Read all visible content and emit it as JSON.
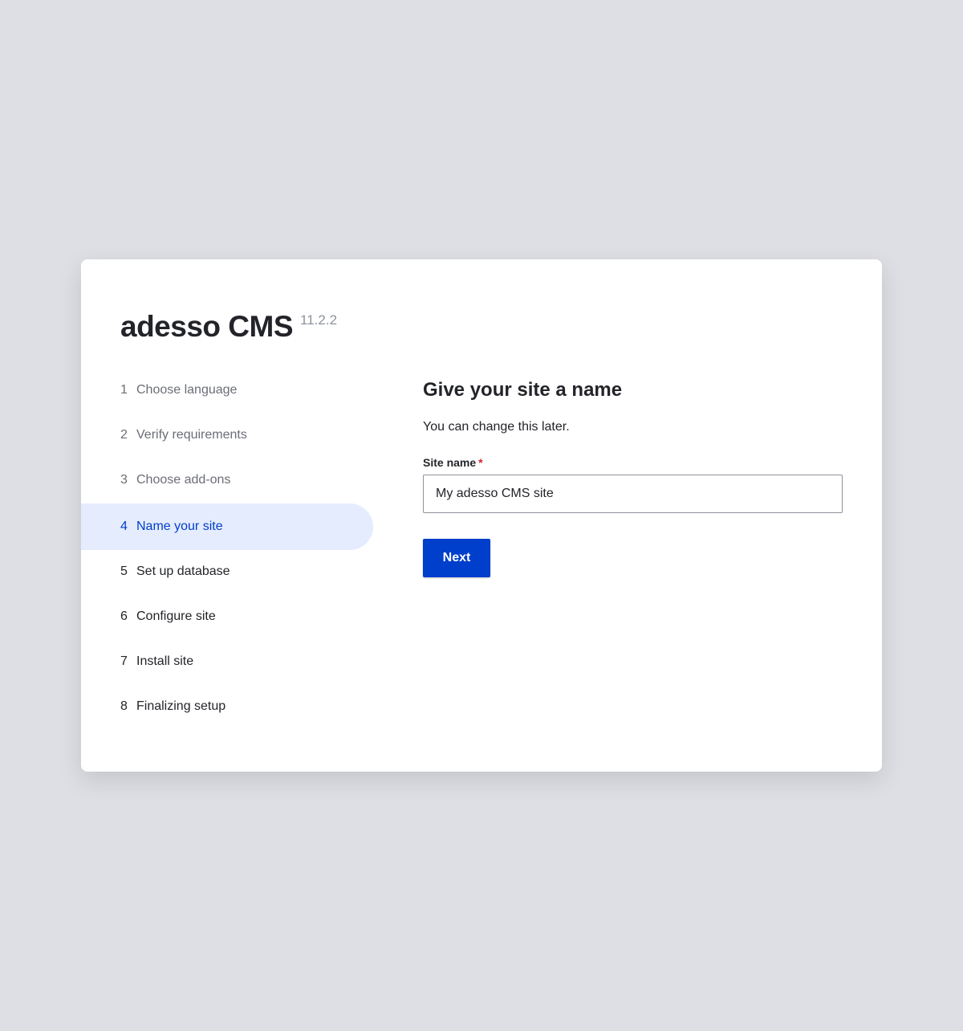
{
  "brand": {
    "name": "adesso CMS",
    "version": "11.2.2"
  },
  "steps": [
    {
      "num": "1",
      "label": "Choose language",
      "state": "done"
    },
    {
      "num": "2",
      "label": "Verify requirements",
      "state": "done"
    },
    {
      "num": "3",
      "label": "Choose add-ons",
      "state": "done"
    },
    {
      "num": "4",
      "label": "Name your site",
      "state": "active"
    },
    {
      "num": "5",
      "label": "Set up database",
      "state": "pending"
    },
    {
      "num": "6",
      "label": "Configure site",
      "state": "pending"
    },
    {
      "num": "7",
      "label": "Install site",
      "state": "pending"
    },
    {
      "num": "8",
      "label": "Finalizing setup",
      "state": "pending"
    }
  ],
  "form": {
    "title": "Give your site a name",
    "description": "You can change this later.",
    "site_name_label": "Site name",
    "required_marker": "*",
    "site_name_value": "My adesso CMS site",
    "next_label": "Next"
  },
  "colors": {
    "accent": "#003ecc",
    "active_bg": "#e5ecfd",
    "required": "#d8202f",
    "background": "#dedfe4"
  }
}
